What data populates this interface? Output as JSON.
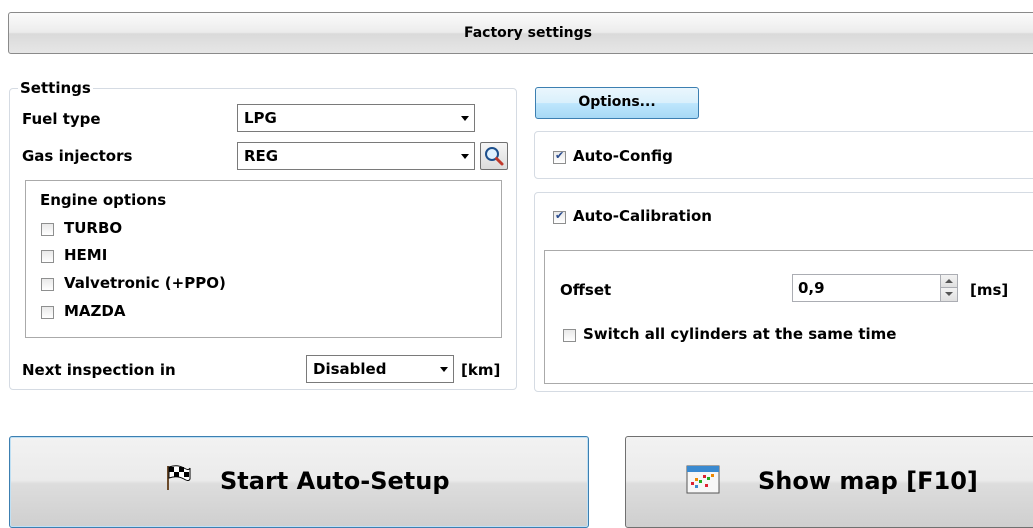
{
  "header": {
    "title": "Factory settings"
  },
  "settings": {
    "legend": "Settings",
    "fuel_type": {
      "label": "Fuel type",
      "value": "LPG"
    },
    "gas_injectors": {
      "label": "Gas injectors",
      "value": "REG"
    },
    "engine_options": {
      "legend": "Engine options",
      "items": [
        {
          "label": "TURBO",
          "checked": false
        },
        {
          "label": "HEMI",
          "checked": false
        },
        {
          "label": "Valvetronic (+PPO)",
          "checked": false
        },
        {
          "label": "MAZDA",
          "checked": false
        }
      ]
    },
    "next_inspection": {
      "label": "Next inspection in",
      "value": "Disabled",
      "unit": "[km]"
    }
  },
  "right_panel": {
    "options_label": "Options...",
    "auto_config": {
      "label": "Auto-Config",
      "checked": true
    },
    "auto_calibration": {
      "label": "Auto-Calibration",
      "checked": true
    },
    "offset": {
      "label": "Offset",
      "value": "0,9",
      "unit": "[ms]"
    },
    "switch_all": {
      "label": "Switch all cylinders at the same time",
      "checked": false
    }
  },
  "buttons": {
    "start_auto_setup": {
      "label": "Start Auto-Setup",
      "icon": "checkered-flag-icon"
    },
    "show_map": {
      "label": "Show map [F10]",
      "icon": "map-chart-icon"
    }
  },
  "colors": {
    "options_button_border": "#3c7fb1",
    "group_border": "#d5dbe3",
    "checkbox_mark": "#2a4b8d"
  }
}
